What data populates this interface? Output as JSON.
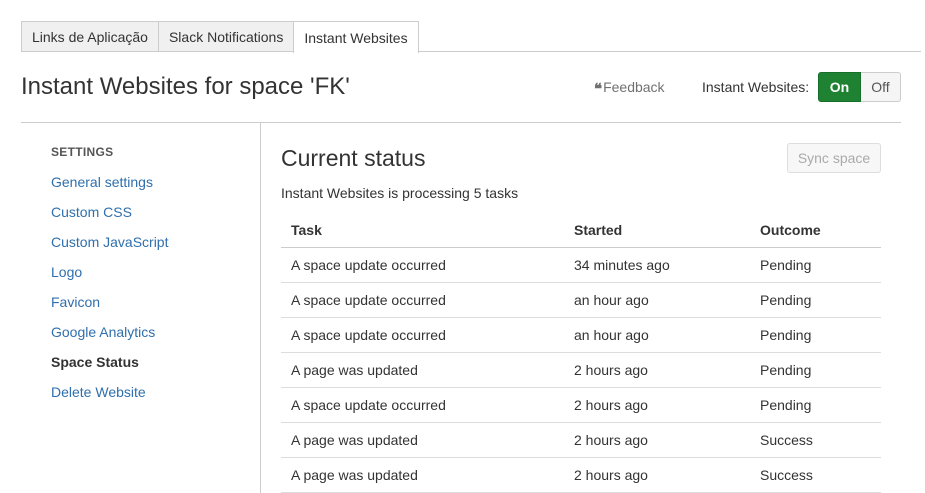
{
  "tabs": [
    {
      "label": "Links de Aplicação",
      "active": false
    },
    {
      "label": "Slack Notifications",
      "active": false
    },
    {
      "label": "Instant Websites",
      "active": true
    }
  ],
  "header": {
    "title": "Instant Websites for space 'FK'",
    "feedback_label": "Feedback",
    "feedback_icon": "quote-icon",
    "toggle_label": "Instant Websites:",
    "toggle_on": "On",
    "toggle_off": "Off",
    "toggle_state": "On"
  },
  "sidebar": {
    "heading": "SETTINGS",
    "items": [
      {
        "label": "General settings"
      },
      {
        "label": "Custom CSS"
      },
      {
        "label": "Custom JavaScript"
      },
      {
        "label": "Logo"
      },
      {
        "label": "Favicon"
      },
      {
        "label": "Google Analytics"
      },
      {
        "label": "Space Status"
      },
      {
        "label": "Delete Website"
      }
    ],
    "current": "Space Status"
  },
  "main": {
    "title": "Current status",
    "sync_button": "Sync space",
    "status_text": "Instant Websites is processing 5 tasks",
    "table": {
      "columns": [
        "Task",
        "Started",
        "Outcome"
      ],
      "rows": [
        [
          "A space update occurred",
          "34 minutes ago",
          "Pending"
        ],
        [
          "A space update occurred",
          "an hour ago",
          "Pending"
        ],
        [
          "A space update occurred",
          "an hour ago",
          "Pending"
        ],
        [
          "A page was updated",
          "2 hours ago",
          "Pending"
        ],
        [
          "A space update occurred",
          "2 hours ago",
          "Pending"
        ],
        [
          "A page was updated",
          "2 hours ago",
          "Success"
        ],
        [
          "A page was updated",
          "2 hours ago",
          "Success"
        ]
      ]
    }
  },
  "colors": {
    "link": "#2f6fad",
    "toggle_on": "#1e8232",
    "border": "#cccccc"
  }
}
